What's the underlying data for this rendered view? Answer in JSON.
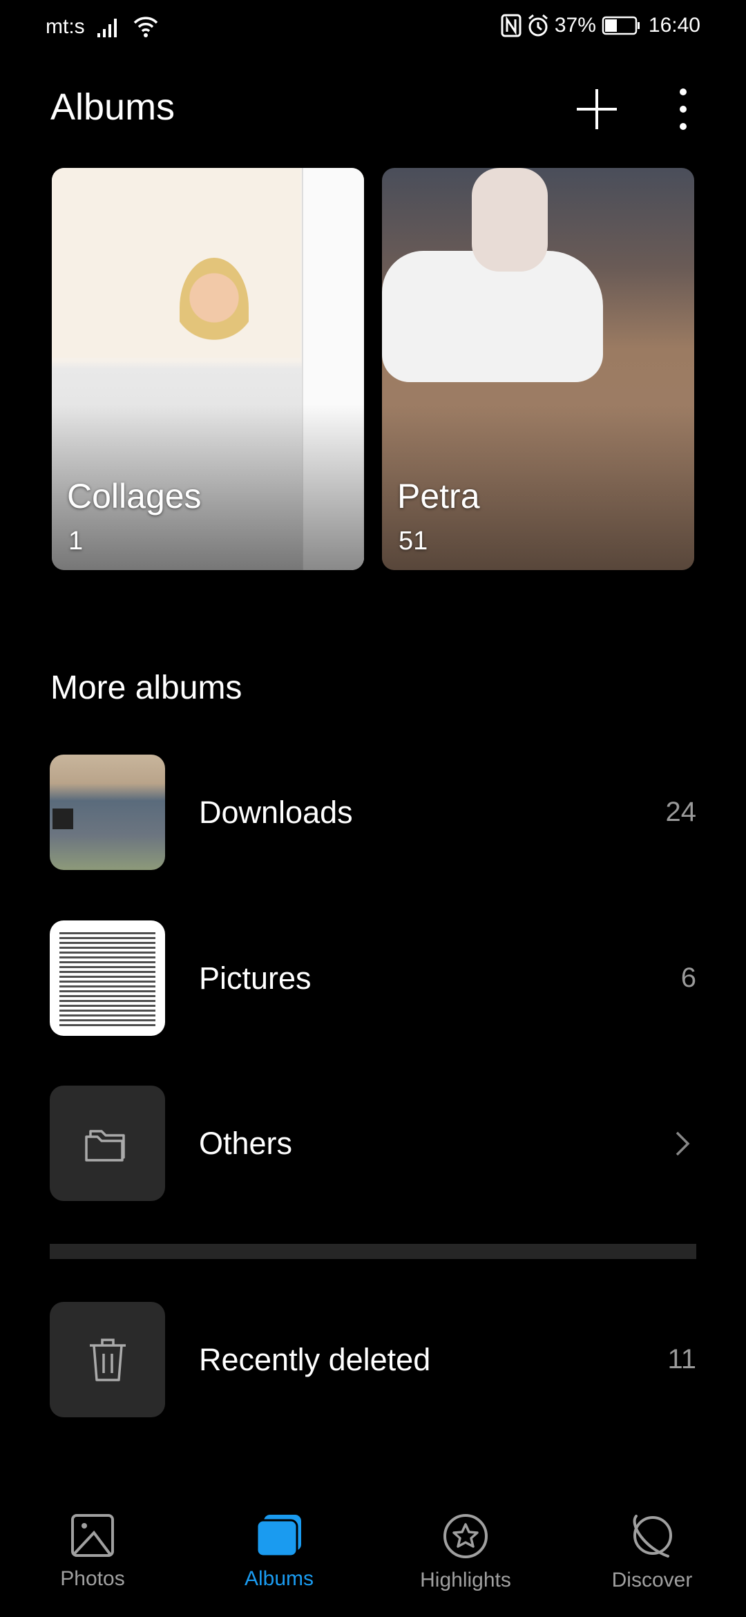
{
  "status_bar": {
    "carrier": "mt:s",
    "battery": "37%",
    "time": "16:40"
  },
  "header": {
    "title": "Albums",
    "add_icon": "plus-icon",
    "more_icon": "more-vertical-icon"
  },
  "albums": [
    {
      "name": "Collages",
      "count": "1"
    },
    {
      "name": "Petra",
      "count": "51"
    }
  ],
  "more_albums": {
    "title": "More albums",
    "items": [
      {
        "label": "Downloads",
        "count": "24"
      },
      {
        "label": "Pictures",
        "count": "6"
      },
      {
        "label": "Others",
        "icon": "folder-icon"
      }
    ]
  },
  "recently_deleted": {
    "label": "Recently deleted",
    "count": "11",
    "icon": "trash-icon"
  },
  "bottom_nav": {
    "active": "Albums",
    "accent": "#1a9bf0",
    "items": [
      {
        "label": "Photos",
        "icon": "image-icon"
      },
      {
        "label": "Albums",
        "icon": "albums-icon"
      },
      {
        "label": "Highlights",
        "icon": "star-circle-icon"
      },
      {
        "label": "Discover",
        "icon": "planet-icon"
      }
    ]
  }
}
